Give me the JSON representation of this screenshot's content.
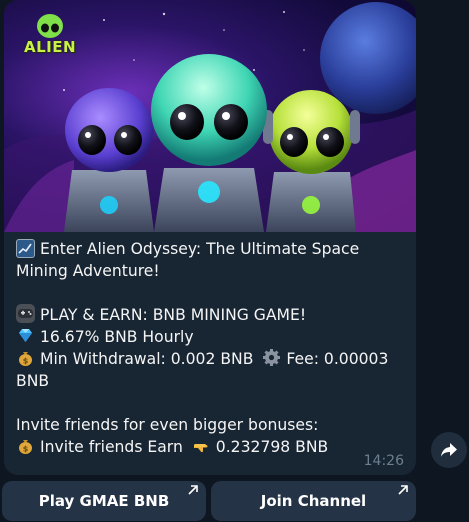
{
  "hero": {
    "logo_text": "ALIEN"
  },
  "message": {
    "line1": "Enter Alien Odyssey: The Ultimate Space Mining Adventure!",
    "line2": "PLAY & EARN: BNB MINING GAME!",
    "line3": "16.67% BNB Hourly",
    "line4a": "Min Withdrawal: 0.002 BNB",
    "line4b": "Fee: 0.00003",
    "line5": "BNB",
    "line6": "Invite friends for even bigger bonuses:",
    "line7a": "Invite friends Earn",
    "line7b": "0.232798 BNB",
    "time": "14:26"
  },
  "icons": {
    "chart": "chart-emoji-icon",
    "gamepad": "gamepad-emoji-icon",
    "gem": "gem-emoji-icon",
    "moneybag": "moneybag-emoji-icon",
    "gear": "gear-emoji-icon",
    "pointing": "pointing-hand-emoji-icon",
    "share": "share-arrow-icon"
  },
  "buttons": {
    "play": "Play GMAE BNB",
    "join": "Join Channel"
  },
  "colors": {
    "chat_bg": "#0e1621",
    "bubble": "#182533",
    "button": "#243345",
    "text": "#f5f5f5",
    "time": "#6d7f8f"
  }
}
